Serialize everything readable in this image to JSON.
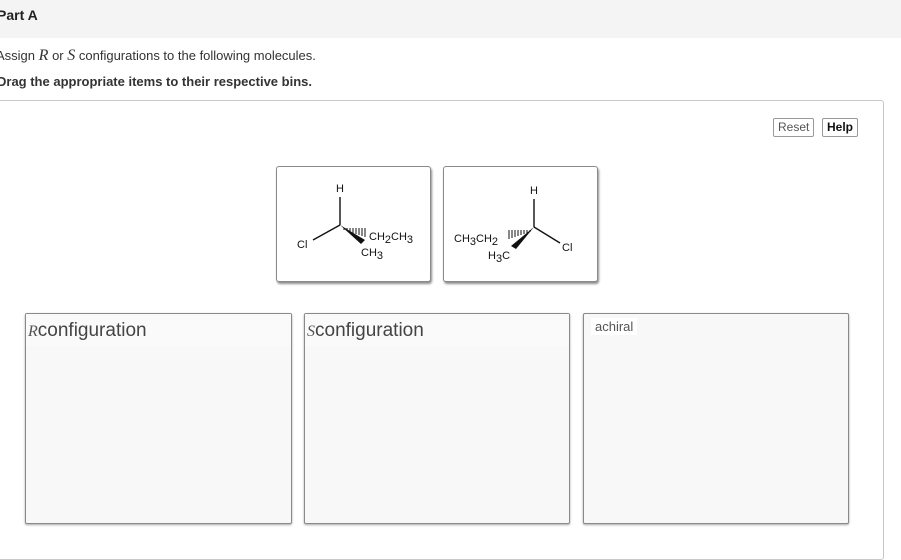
{
  "header": {
    "title": "Part A"
  },
  "instruction": {
    "prefix": "Assign",
    "r_symbol": "R",
    "or_text": "or",
    "s_symbol": "S",
    "suffix": "configurations to the following molecules."
  },
  "drag_note": "Drag the appropriate items to their respective bins.",
  "toolbar": {
    "reset_label": "Reset",
    "help_label": "Help"
  },
  "molecules": [
    {
      "labels": {
        "h": "H",
        "cl": "Cl",
        "ethyl_main": "CH",
        "ethyl_mid": "CH",
        "sub2": "2",
        "sub3": "3",
        "methyl_main": "CH",
        "methyl_sub": "3"
      }
    },
    {
      "labels": {
        "h": "H",
        "cl": "Cl",
        "ethyl_main": "CH",
        "ethyl_mid": "CH",
        "sub3": "3",
        "sub2": "2",
        "methyl_h": "H",
        "methyl_sub": "3",
        "methyl_c": "C"
      }
    }
  ],
  "bins": {
    "r": {
      "symbol": "R",
      "label": "configuration"
    },
    "s": {
      "symbol": "S",
      "label": "configuration"
    },
    "achiral": {
      "label": "achiral"
    }
  }
}
